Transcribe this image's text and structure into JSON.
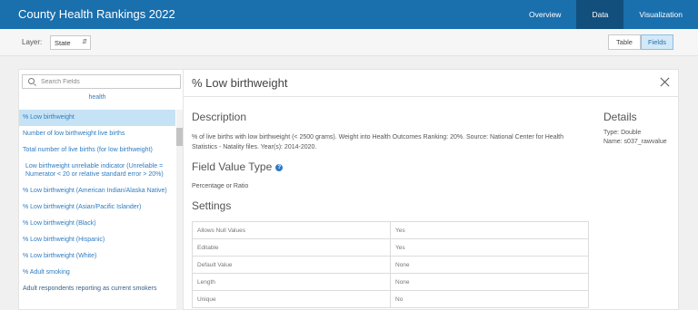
{
  "header": {
    "title": "County Health Rankings 2022",
    "nav": [
      "Overview",
      "Data",
      "Visualization"
    ],
    "active_nav": "Data"
  },
  "toolbar": {
    "layer_label": "Layer:",
    "layer_value": "State",
    "view_options": [
      "Table",
      "Fields"
    ],
    "active_view": "Fields"
  },
  "sidebar": {
    "search_placeholder": "Search Fields",
    "group_header": "health",
    "fields": [
      "% Low birthweight",
      "Number of low birthweight live births",
      "Total number of live births (for low birthweight)",
      "Low birthweight unreliable indicator (Unreliable = Numerator < 20 or relative standard error > 20%)",
      "% Low birthweight (American Indian/Alaska Native)",
      "% Low birthweight (Asian/Pacific Islander)",
      "% Low birthweight (Black)",
      "% Low birthweight (Hispanic)",
      "% Low birthweight (White)",
      "% Adult smoking",
      "Adult respondents reporting as current smokers"
    ],
    "selected_field": "% Low birthweight"
  },
  "detail": {
    "title": "% Low birthweight",
    "description_heading": "Description",
    "description": "% of live births with low birthweight (< 2500 grams). Weight into Health Outcomes Ranking: 20%. Source: National Center for Health Statistics - Natality files. Year(s): 2014-2020.",
    "field_value_type_heading": "Field Value Type",
    "field_value_type": "Percentage or Ratio",
    "settings_heading": "Settings",
    "settings": [
      {
        "key": "Allows Null Values",
        "value": "Yes"
      },
      {
        "key": "Editable",
        "value": "Yes"
      },
      {
        "key": "Default Value",
        "value": "None"
      },
      {
        "key": "Length",
        "value": "None"
      },
      {
        "key": "Unique",
        "value": "No"
      }
    ],
    "details_heading": "Details",
    "details_type": "Type: Double",
    "details_name": "Name: s037_rawvalue"
  },
  "icons": {
    "search": "search-icon",
    "close": "close-icon",
    "info": "info-icon",
    "dropdown": "chevron-down-icon"
  },
  "colors": {
    "header_bg": "#1a6fad",
    "active_nav_bg": "#134f7c",
    "link": "#2f7cc0",
    "selected_row": "#c6e2f5"
  }
}
